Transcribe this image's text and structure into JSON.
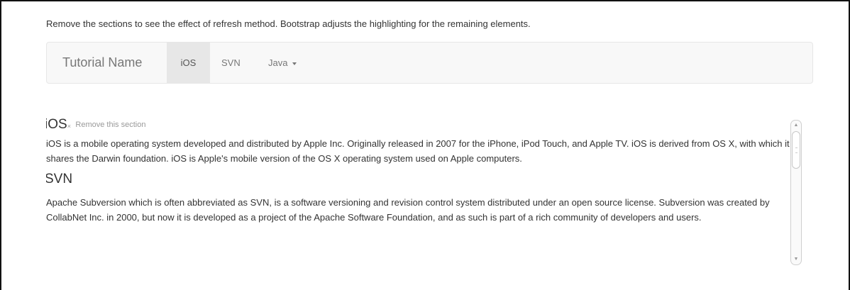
{
  "intro_text": "Remove the sections to see the effect of refresh method. Bootstrap adjusts the highlighting for the remaining elements.",
  "navbar": {
    "brand": "Tutorial Name",
    "items": [
      {
        "label": "iOS",
        "active": true
      },
      {
        "label": "SVN",
        "active": false
      },
      {
        "label": "Java",
        "dropdown": true
      }
    ]
  },
  "sections": {
    "ios": {
      "heading": "iOS",
      "remove_icon": "×",
      "remove_label": "Remove this section",
      "body": "iOS is a mobile operating system developed and distributed by Apple Inc. Originally released in 2007 for the iPhone, iPod Touch, and Apple TV. iOS is derived from OS X, with which it shares the Darwin foundation. iOS is Apple's mobile version of the OS X operating system used on Apple computers."
    },
    "svn": {
      "heading": "SVN",
      "body": "Apache Subversion which is often abbreviated as SVN, is a software versioning and revision control system distributed under an open source license. Subversion was created by CollabNet Inc. in 2000, but now it is developed as a project of the Apache Software Foundation, and as such is part of a rich community of developers and users."
    }
  },
  "scrollbar": {
    "up_icon": "▲",
    "down_icon": "▼"
  }
}
